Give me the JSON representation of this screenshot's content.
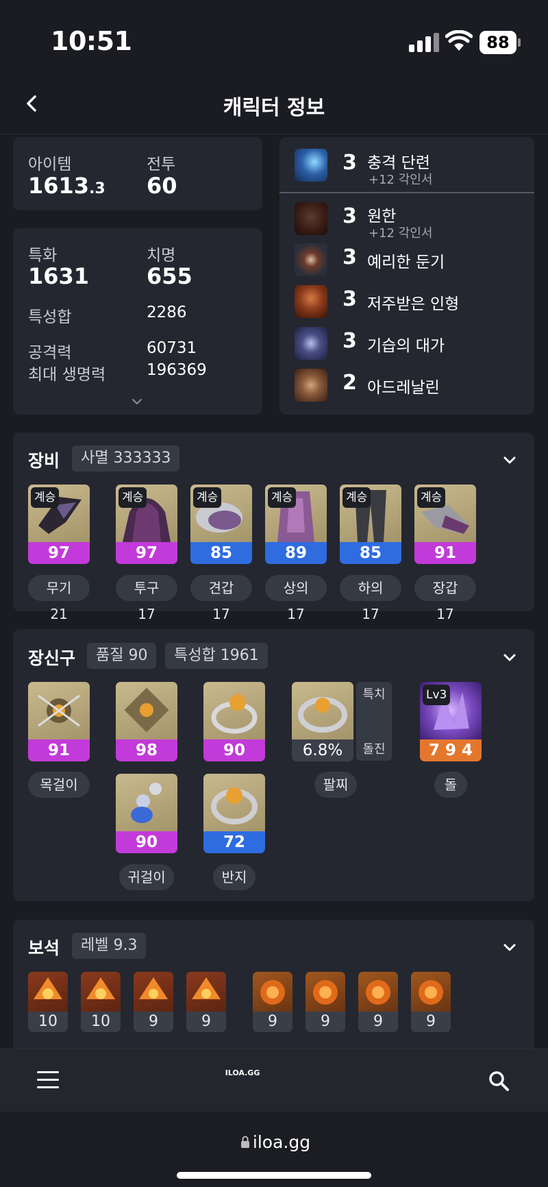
{
  "status_bar": {
    "time": "10:51",
    "battery": "88"
  },
  "nav": {
    "title": "캐릭터 정보"
  },
  "summary": {
    "item_label": "아이템",
    "item_level_main": "1613",
    "item_level_decimal": ".3",
    "combat_label": "전투",
    "combat_value": "60"
  },
  "stats": {
    "spec_label": "특화",
    "spec_value": "1631",
    "crit_label": "치명",
    "crit_value": "655",
    "total_label": "특성합",
    "total_value": "2286",
    "attack_label": "공격력",
    "attack_value": "60731",
    "hp_label": "최대 생명력",
    "hp_value": "196369"
  },
  "engravings": [
    {
      "level": "3",
      "name": "충격 단련",
      "sub": "+12 각인서",
      "icon": "shock-engraving-icon"
    },
    {
      "level": "3",
      "name": "원한",
      "sub": "+12 각인서",
      "icon": "grudge-engraving-icon"
    },
    {
      "level": "3",
      "name": "예리한 둔기",
      "sub": "",
      "icon": "keen-blunt-engraving-icon"
    },
    {
      "level": "3",
      "name": "저주받은 인형",
      "sub": "",
      "icon": "cursed-doll-engraving-icon"
    },
    {
      "level": "3",
      "name": "기습의 대가",
      "sub": "",
      "icon": "master-ambush-engraving-icon"
    },
    {
      "level": "2",
      "name": "아드레날린",
      "sub": "",
      "icon": "adrenaline-engraving-icon"
    }
  ],
  "equipment": {
    "title": "장비",
    "set_tag": "사멸 333333",
    "badge": "계승",
    "items": [
      {
        "quality": "97",
        "color": "purple",
        "label": "무기 21"
      },
      {
        "quality": "97",
        "color": "purple",
        "label": "투구 17"
      },
      {
        "quality": "85",
        "color": "blue",
        "label": "견갑 17"
      },
      {
        "quality": "89",
        "color": "blue",
        "label": "상의 17"
      },
      {
        "quality": "85",
        "color": "blue",
        "label": "하의 17"
      },
      {
        "quality": "91",
        "color": "purple",
        "label": "장갑 17"
      }
    ]
  },
  "accessories": {
    "title": "장신구",
    "quality_tag": "품질 90",
    "total_tag": "특성합 1961",
    "items": [
      {
        "quality": "91",
        "color": "purple",
        "label": "목걸이"
      },
      {
        "quality": "98",
        "color": "purple",
        "label": ""
      },
      {
        "quality": "90",
        "color": "purple",
        "label": ""
      },
      {
        "quality": "90",
        "color": "purple",
        "label": "귀걸이"
      },
      {
        "quality": "72",
        "color": "blue",
        "label": "반지"
      }
    ],
    "bracelet": {
      "value": "6.8%",
      "label": "팔찌",
      "stat1": "특치",
      "stat2": "돌진"
    },
    "stone": {
      "level": "Lv3",
      "value": "7 9 4",
      "label": "돌"
    }
  },
  "gems": {
    "title": "보석",
    "level_tag": "레벨 9.3",
    "items": [
      "10",
      "10",
      "9",
      "9",
      "9",
      "9",
      "9",
      "9"
    ]
  },
  "bottom": {
    "logo": "ILOA.GG",
    "url": "iloa.gg"
  },
  "colors": {
    "purple": "#c23ad9",
    "blue": "#2e6ce0",
    "orange": "#e4772e",
    "card": "#24272f",
    "background": "#1a1c22"
  }
}
